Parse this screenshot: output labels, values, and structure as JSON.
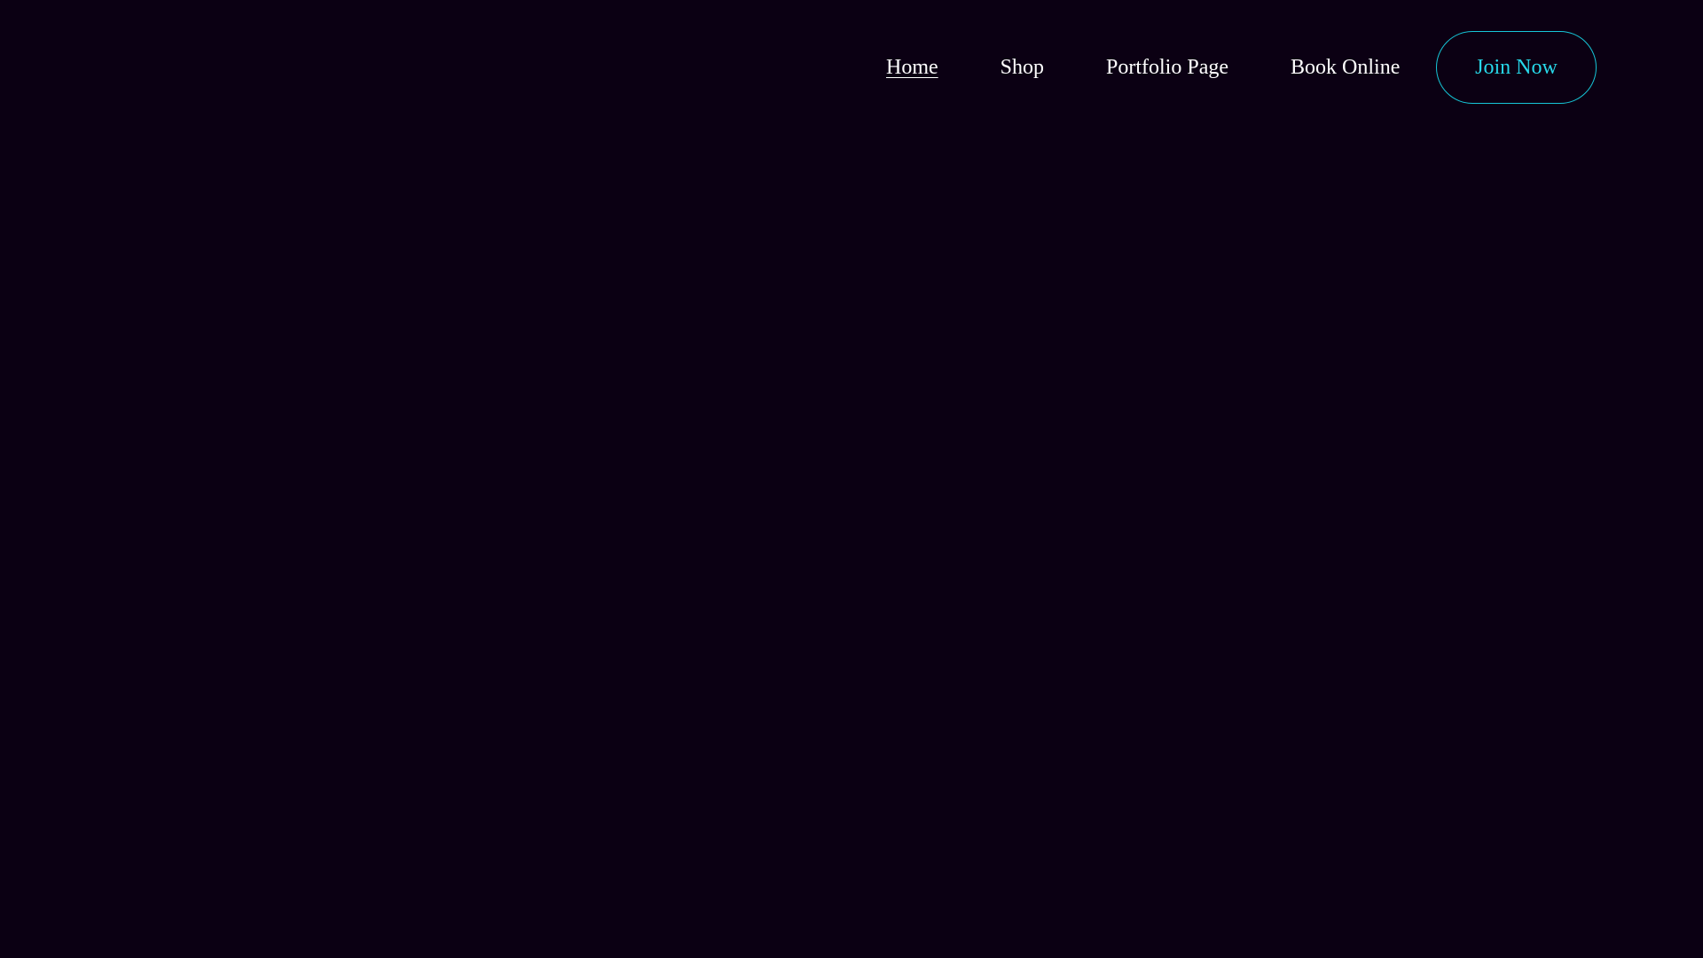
{
  "header": {
    "nav": {
      "items": [
        {
          "id": "home",
          "label": "Home",
          "active": true
        },
        {
          "id": "shop",
          "label": "Shop",
          "active": false
        },
        {
          "id": "portfolio",
          "label": "Portfolio Page",
          "active": false
        },
        {
          "id": "book",
          "label": "Book Online",
          "active": false
        }
      ]
    },
    "cta": {
      "label": "Join Now"
    }
  },
  "theme": {
    "background": "#0b0013",
    "text": "#ffffff",
    "accent": "#27d8ea",
    "accent_border": "#16c6d8"
  }
}
